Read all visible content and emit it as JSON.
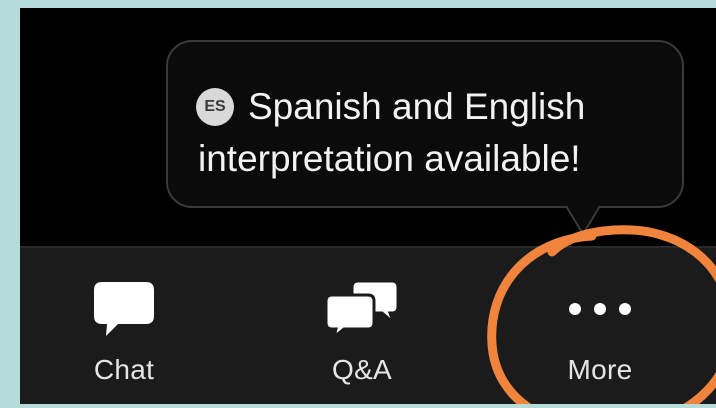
{
  "tooltip": {
    "badge": "ES",
    "line1": "Spanish and English",
    "line2": "interpretation available!"
  },
  "toolbar": {
    "chat_label": "Chat",
    "qa_label": "Q&A",
    "more_label": "More"
  },
  "icons": {
    "chat": "chat-bubble-icon",
    "qa": "qa-bubbles-icon",
    "more": "more-dots-icon"
  },
  "colors": {
    "highlight_ring": "#f0843c",
    "screen_bg": "#000000",
    "toolbar_bg": "#1b1b1b",
    "icon_white": "#ffffff",
    "outer_bg": "#b5dcd8"
  }
}
